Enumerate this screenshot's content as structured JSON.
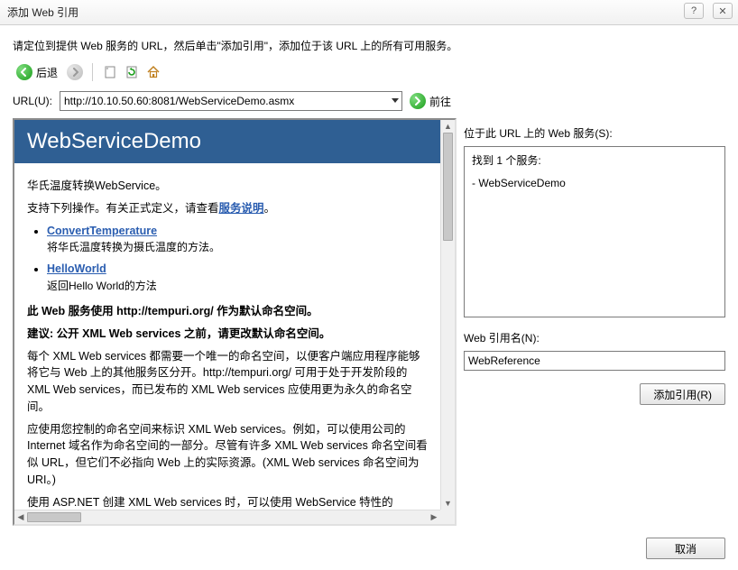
{
  "window": {
    "title": "添加 Web 引用",
    "help_icon": "?",
    "close_icon": "✕"
  },
  "instruction": "请定位到提供 Web 服务的 URL，然后单击\"添加引用\"，添加位于该 URL 上的所有可用服务。",
  "toolbar": {
    "back_label": "后退"
  },
  "url": {
    "label": "URL(U):",
    "value": "http://10.10.50.60:8081/WebServiceDemo.asmx",
    "go_label": "前往"
  },
  "page": {
    "banner_title": "WebServiceDemo",
    "intro": "华氏温度转换WebService。",
    "ops_prefix": "支持下列操作。有关正式定义，请查看",
    "ops_link": "服务说明",
    "ops_suffix": "。",
    "operations": [
      {
        "name": "ConvertTemperature",
        "desc": "将华氏温度转换为摄氏温度的方法。"
      },
      {
        "name": "HelloWorld",
        "desc": "返回Hello World的方法"
      }
    ],
    "ns_line": "此 Web 服务使用 http://tempuri.org/ 作为默认命名空间。",
    "rec_line": "建议: 公开 XML Web services 之前，请更改默认命名空间。",
    "para1": "每个 XML Web services 都需要一个唯一的命名空间，以便客户端应用程序能够将它与 Web 上的其他服务区分开。http://tempuri.org/ 可用于处于开发阶段的 XML Web services，而已发布的 XML Web services 应使用更为永久的命名空间。",
    "para2": "应使用您控制的命名空间来标识 XML Web services。例如，可以使用公司的 Internet 域名作为命名空间的一部分。尽管有许多 XML Web services 命名空间看似 URL，但它们不必指向 Web 上的实际资源。(XML Web services 命名空间为 URI。)",
    "para3": "使用 ASP.NET 创建 XML Web services 时，可以使用 WebService 特性的 Namespace 属性更改默认命名空间。WebService 特性适用于包含 XML Web"
  },
  "right": {
    "services_label": "位于此 URL 上的 Web 服务(S):",
    "found_text": "找到 1 个服务:",
    "service_item": "- WebServiceDemo",
    "refname_label": "Web 引用名(N):",
    "refname_value": "WebReference",
    "add_button": "添加引用(R)"
  },
  "footer": {
    "cancel": "取消"
  }
}
